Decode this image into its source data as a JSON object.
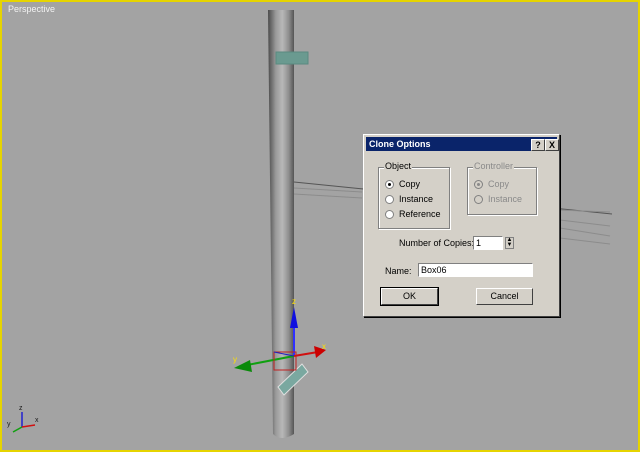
{
  "viewport": {
    "label": "Perspective"
  },
  "scene": {
    "axis_gizmo": {
      "z": "z",
      "y": "y",
      "x": "x"
    },
    "corner_axes": {
      "z": "z",
      "y": "y",
      "x": "x"
    }
  },
  "dialog": {
    "title": "Clone Options",
    "help_label": "?",
    "close_label": "X",
    "object_group": {
      "label": "Object",
      "options": [
        "Copy",
        "Instance",
        "Reference"
      ],
      "selected": "Copy"
    },
    "controller_group": {
      "label": "Controller",
      "options": [
        "Copy",
        "Instance"
      ],
      "selected": "Copy"
    },
    "copies_label": "Number of Copies:",
    "copies_value": "1",
    "name_label": "Name:",
    "name_value": "Box06",
    "ok_label": "OK",
    "cancel_label": "Cancel"
  }
}
